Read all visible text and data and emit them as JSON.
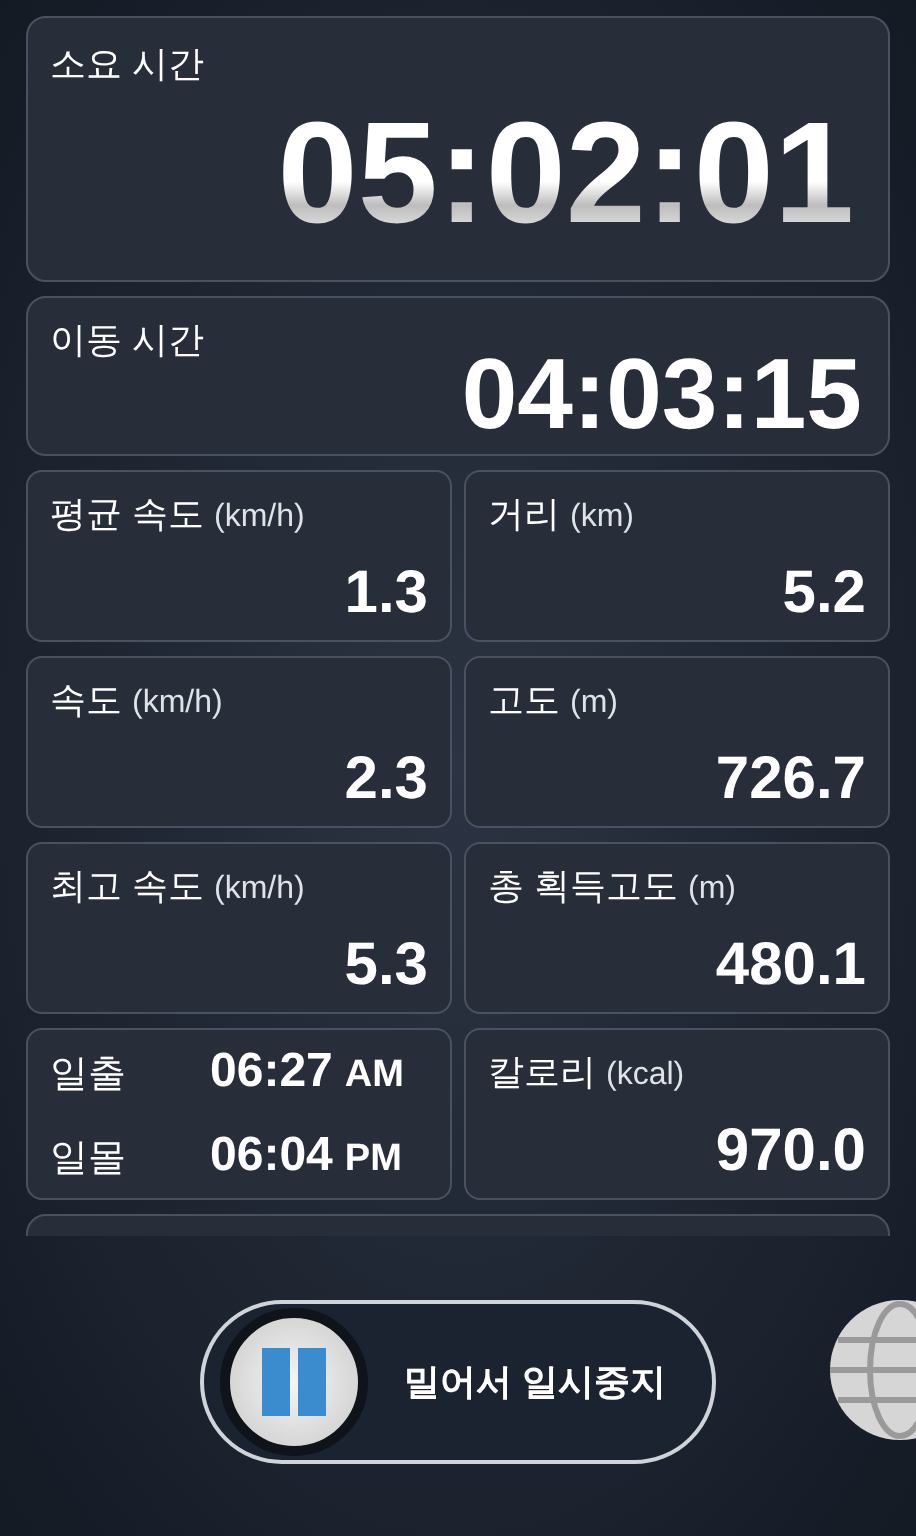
{
  "elapsed": {
    "label": "소요 시간",
    "value": "05:02:01"
  },
  "moving": {
    "label": "이동 시간",
    "value": "04:03:15"
  },
  "cards": [
    {
      "kind": "stat",
      "label": "평균 속도",
      "unit": "(km/h)",
      "value": "1.3"
    },
    {
      "kind": "stat",
      "label": "거리",
      "unit": "(km)",
      "value": "5.2"
    },
    {
      "kind": "stat",
      "label": "속도",
      "unit": "(km/h)",
      "value": "2.3"
    },
    {
      "kind": "stat",
      "label": "고도",
      "unit": "(m)",
      "value": "726.7"
    },
    {
      "kind": "stat",
      "label": "최고 속도",
      "unit": "(km/h)",
      "value": "5.3"
    },
    {
      "kind": "stat",
      "label": "총 획득고도",
      "unit": "(m)",
      "value": "480.1"
    },
    {
      "kind": "sun",
      "rows": [
        {
          "label": "일출",
          "time": "06:27",
          "suffix": "AM"
        },
        {
          "label": "일몰",
          "time": "06:04",
          "suffix": "PM"
        }
      ]
    },
    {
      "kind": "stat",
      "label": "칼로리",
      "unit": "(kcal)",
      "value": "970.0"
    }
  ],
  "slider": {
    "label": "밀어서 일시중지"
  }
}
